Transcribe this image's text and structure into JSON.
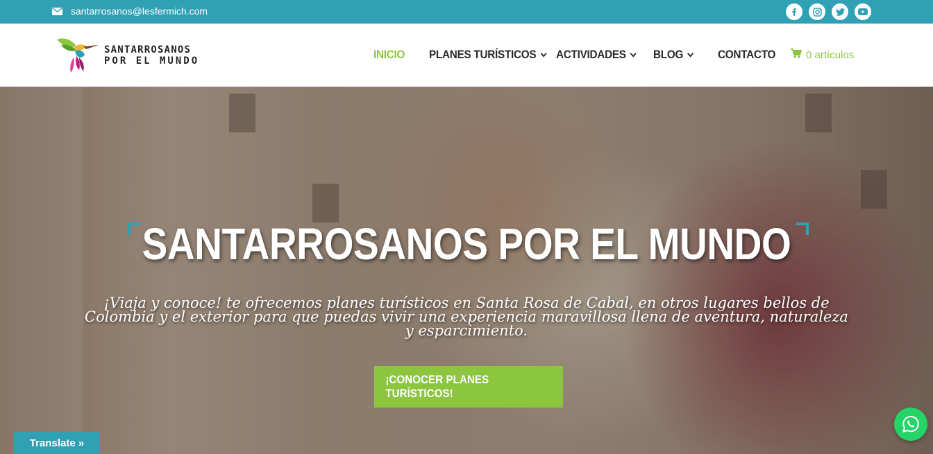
{
  "topbar": {
    "email": "santarrosanos@lesfermich.com",
    "social_icons": [
      "facebook-icon",
      "instagram-icon",
      "twitter-icon",
      "youtube-icon"
    ]
  },
  "logo": {
    "line1": "SANTARROSANOS",
    "line2": "POR EL MUNDO"
  },
  "nav": {
    "items": [
      {
        "label": "INICIO",
        "active": true,
        "dropdown": false
      },
      {
        "label": "PLANES TURÍSTICOS",
        "active": false,
        "dropdown": true
      },
      {
        "label": "ACTIVIDADES",
        "active": false,
        "dropdown": true
      },
      {
        "label": "BLOG",
        "active": false,
        "dropdown": true
      },
      {
        "label": "CONTACTO",
        "active": false,
        "dropdown": false
      }
    ],
    "cart_label": "0 artículos"
  },
  "hero": {
    "title": "SANTARROSANOS POR EL MUNDO",
    "subtitle": "¡Viaja y conoce! te ofrecemos planes turísticos en Santa Rosa de Cabal, en otros lugares bellos de Colombia y el exterior para que puedas vivir una experiencia maravillosa llena de aventura, naturaleza y esparcimiento.",
    "cta_label": "¡CONOCER PLANES TURÍSTICOS!"
  },
  "translate_label": "Translate »",
  "colors": {
    "accent_teal": "#30a0b4",
    "accent_green": "#8cc63f",
    "whatsapp_green": "#25d366"
  }
}
